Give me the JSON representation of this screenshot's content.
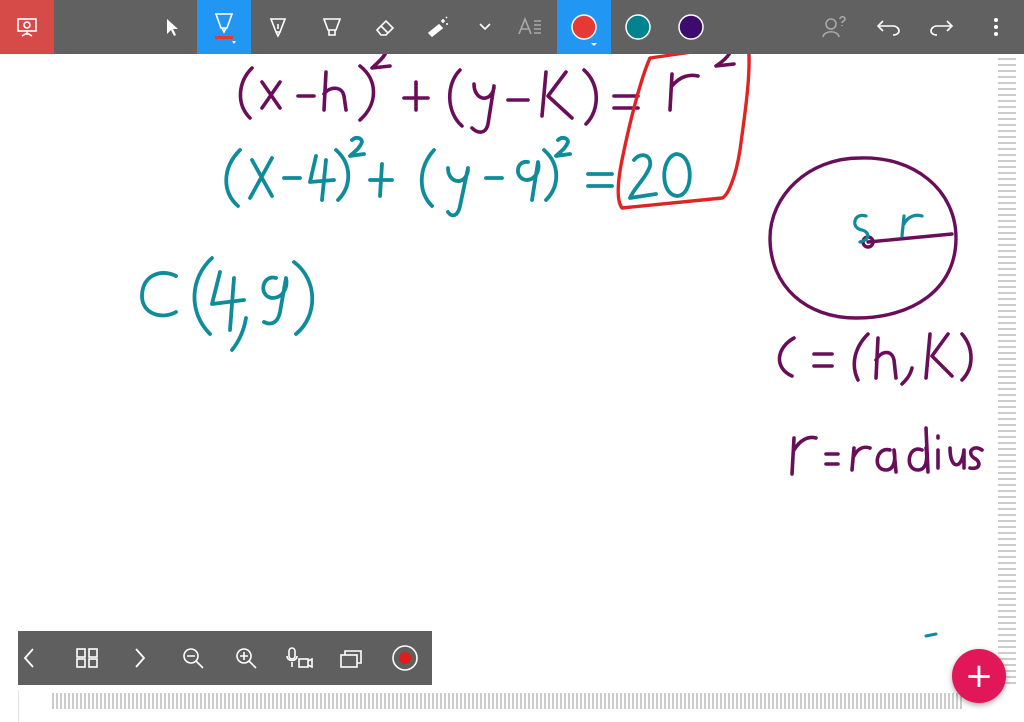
{
  "toolbar": {
    "tools": [
      "presenter-icon",
      "select-icon",
      "highlighter-pen-icon",
      "fountain-pen-icon",
      "marker-icon",
      "eraser-icon",
      "laser-pointer-icon",
      "chevron-down-icon",
      "text-icon"
    ],
    "active_tool": "highlighter-pen-icon",
    "colors": {
      "red": "#e53935",
      "teal": "#00838f",
      "purple": "#3d0a6e"
    },
    "active_color": "red"
  },
  "bottombar": {
    "items": [
      "previous-page-icon",
      "page-grid-icon",
      "next-page-icon",
      "zoom-out-icon",
      "zoom-in-icon",
      "audio-video-record-icon",
      "copy-pages-icon",
      "record-button-icon"
    ]
  },
  "fab": {
    "label": "+"
  },
  "ink_colors": {
    "purple": "#6b0e5a",
    "teal": "#0f8c9a",
    "red": "#e02424"
  }
}
